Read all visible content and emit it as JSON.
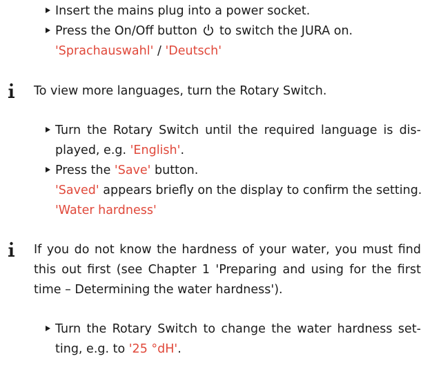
{
  "steps": {
    "insert_plug": "Insert the mains plug into a power socket.",
    "press_onoff_a": "Press the On/Off button",
    "power_icon": "power-icon",
    "press_onoff_b": "to switch the JURA on.",
    "display_lang_1": "'Sprachauswahl'",
    "display_sep": " / ",
    "display_lang_2": "'Deutsch'",
    "turn_rotary_a": "Turn the Rotary Switch until the required language is dis-",
    "turn_rotary_b": "played, e.g. ",
    "turn_rotary_english": "'English'",
    "turn_rotary_c": ".",
    "press_save_a": "Press the ",
    "press_save_btn": "'Save'",
    "press_save_b": " button.",
    "saved_label": "'Saved'",
    "saved_text": " appears briefly on the display to confirm the setting.",
    "water_hardness": "'Water hardness'",
    "turn_hardness_a": "Turn the Rotary Switch to change the water hardness set-",
    "turn_hardness_b": "ting, e.g. to ",
    "turn_hardness_value": "'25 °dH'",
    "turn_hardness_c": "."
  },
  "info": {
    "languages": "To view more languages, turn the Rotary Switch.",
    "hardness_line1": "If you do not know the hardness of your water, you must find",
    "hardness_line2": "this out first (see Chapter 1 'Preparing and using for the first",
    "hardness_line3": "time – Determining the water hardness')."
  },
  "icons": {
    "info": "info-icon",
    "bullet": "triangle-bullet-icon"
  },
  "colors": {
    "display_text": "#e0483a",
    "body_text": "#1a1a1a"
  }
}
